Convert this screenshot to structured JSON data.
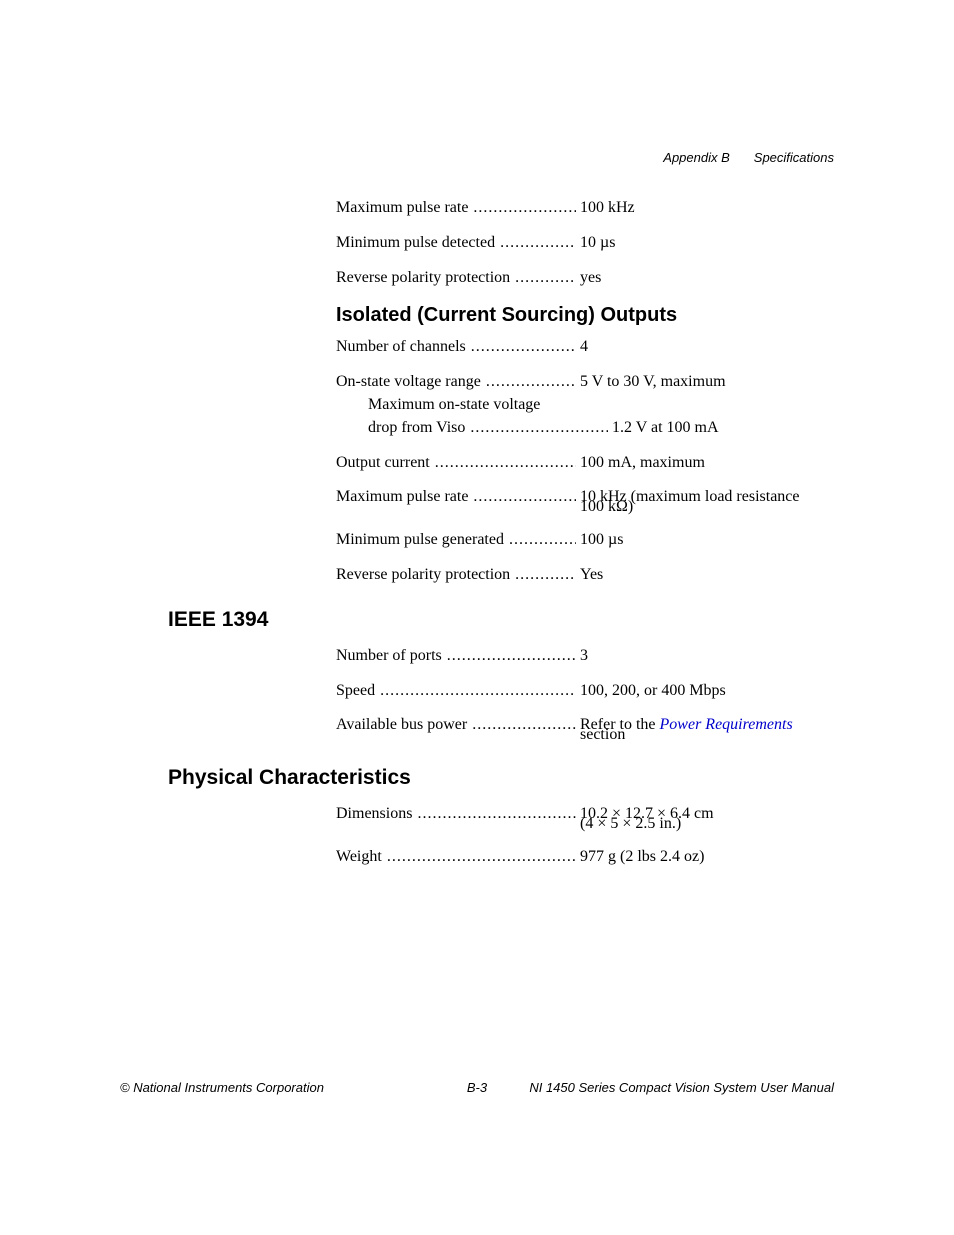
{
  "header": {
    "left": "Appendix B",
    "right": "Specifications"
  },
  "top_specs": [
    {
      "label": "Maximum pulse rate",
      "value": "100 kHz"
    },
    {
      "label": "Minimum pulse detected",
      "value": "10 µs"
    },
    {
      "label": "Reverse polarity protection",
      "value": "yes"
    }
  ],
  "subhead1": "Isolated (Current Sourcing) Outputs",
  "iso_specs": {
    "channels": {
      "label": "Number of channels",
      "value": "4"
    },
    "onstate": {
      "label": "On-state voltage range",
      "value": "5 V to 30 V, maximum"
    },
    "onstate_sub_label": "Maximum on-state voltage",
    "onstate_sub": {
      "label": "drop from Viso",
      "value": "1.2 V at 100 mA"
    },
    "outcur": {
      "label": "Output current",
      "value": "100 mA, maximum"
    },
    "maxpulse": {
      "label": "Maximum pulse rate",
      "value": "10 kHz (maximum load resistance"
    },
    "maxpulse_cont": "100 kΩ)",
    "minpulse": {
      "label": "Minimum pulse generated",
      "value": "100 µs"
    },
    "revpol": {
      "label": "Reverse polarity protection",
      "value": "Yes"
    }
  },
  "section2": "IEEE 1394",
  "ieee_specs": {
    "ports": {
      "label": "Number of ports",
      "value": "3"
    },
    "speed": {
      "label": "Speed",
      "value": "100, 200, or 400 Mbps"
    },
    "power": {
      "label": "Available bus power",
      "value_pre": "Refer to the ",
      "link": "Power Requirements",
      "value_cont": "section"
    }
  },
  "section3": "Physical Characteristics",
  "phys_specs": {
    "dim": {
      "label": "Dimensions",
      "value": "10.2 × 12.7 × 6.4 cm",
      "value_cont": "(4 × 5 × 2.5 in.)"
    },
    "weight": {
      "label": "Weight",
      "value": "977 g (2 lbs 2.4 oz)"
    }
  },
  "footer": {
    "left": "© National Instruments Corporation",
    "center": "B-3",
    "right": "NI 1450 Series Compact Vision System User Manual"
  }
}
